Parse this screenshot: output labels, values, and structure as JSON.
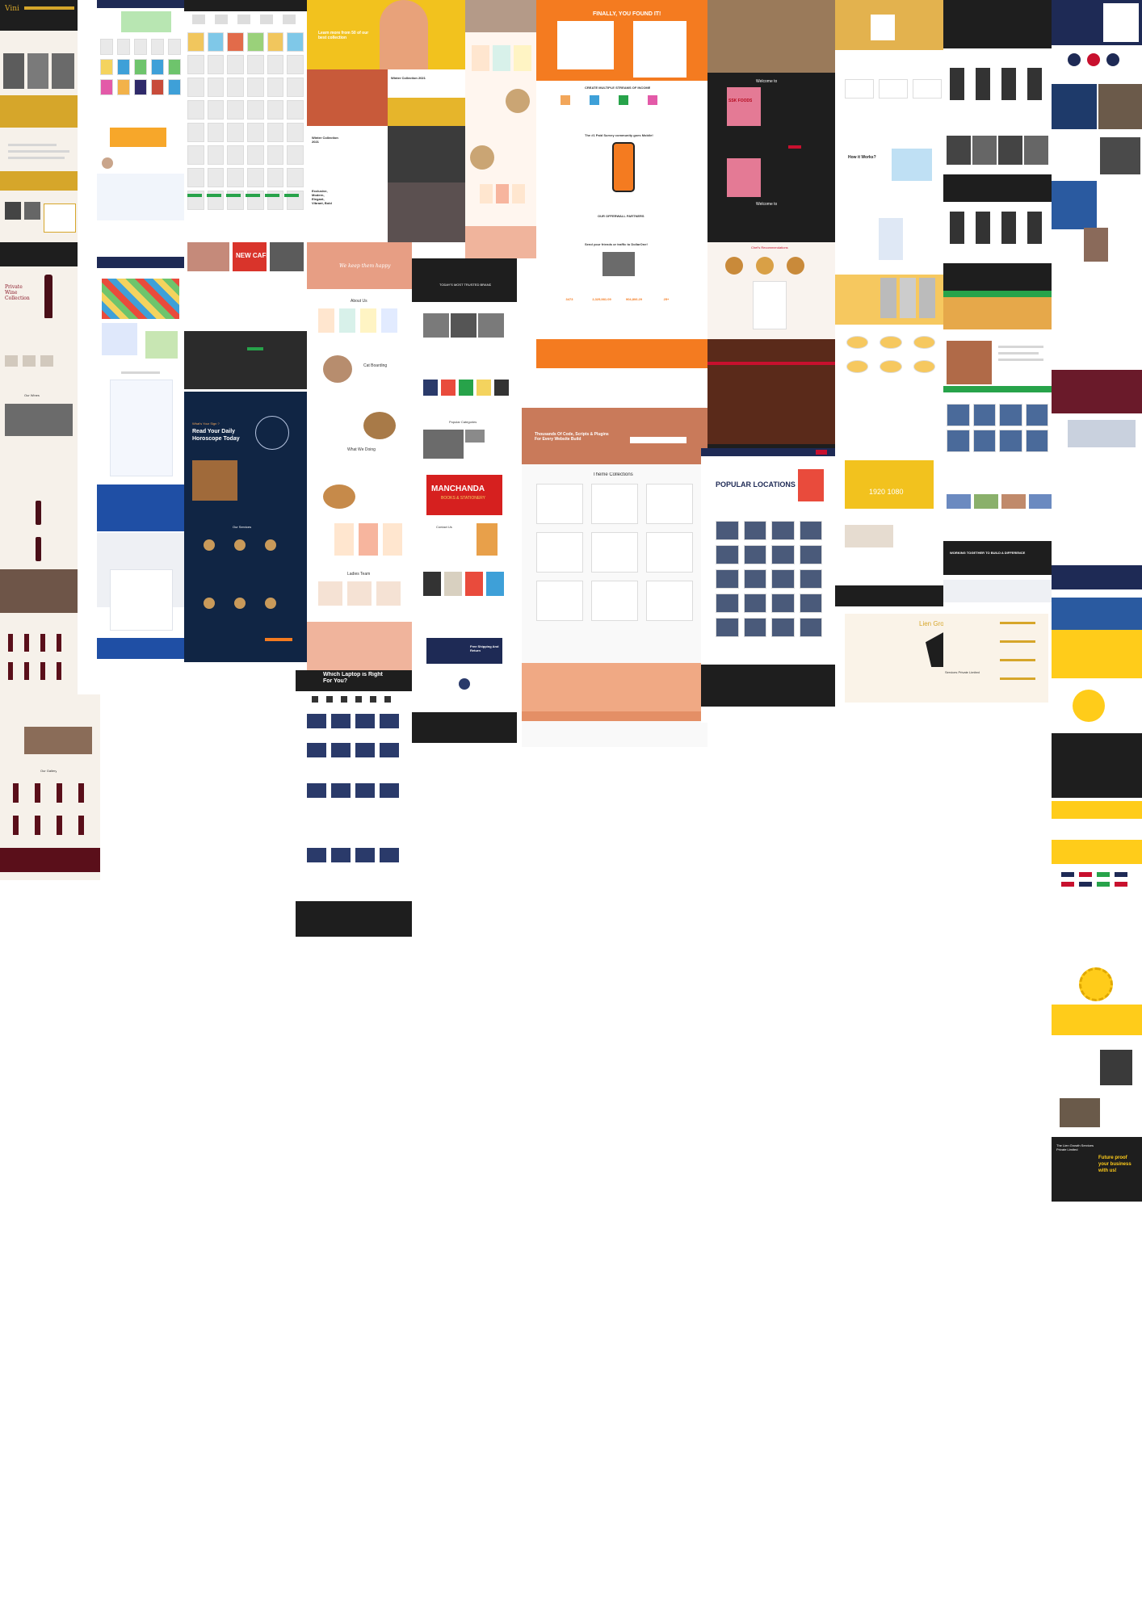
{
  "col_wine": {
    "logo": "Vini",
    "private_collection": "Private\nWine\nCollection",
    "our_wines": "Our Wines",
    "our_gallery": "Our Gallery"
  },
  "col_shop": {
    "cta": "Shop Now"
  },
  "col_store": {
    "promo": "NEW CAFE",
    "horoscope_title": "What's Your Sign ?",
    "horoscope_heading": "Read Your Daily Horoscope Today",
    "our_services": "Our Services"
  },
  "col_fashion": {
    "hero": "Learn more from 50 of our best collection",
    "winter_1": "Winter Collection 2021",
    "winter_2": "Winter Collection 2021",
    "exclusive": "Exclusive, Modern, Elegant, Vibrant, Bold"
  },
  "col_laptop": {
    "title": "Which Laptop is Right For You?"
  },
  "col_pet": {
    "hero": "We keep them happy",
    "about": "About Us",
    "cat_boarding": "Cat Boarding",
    "what_we_doing": "What We Doing",
    "ladies_team": "Ladies Team"
  },
  "col_books": {
    "tagline": "TODAY'S MOST TRUSTED BRAND",
    "brand_name": "MANCHANDA",
    "brand_sub": "BOOKS & STATIONERY",
    "popular_categories": "Popular Categories",
    "contact": "Contact Us",
    "free_shipping": "Free Shipping And Return"
  },
  "col_survey": {
    "title": "FINALLY, YOU FOUND IT!",
    "streams": "CREATE MULTIPLE STREAMS OF INCOME",
    "mobile_title": "The #1 Paid Survey community goes Mobile!",
    "partners": "OUR OFFERWALL PARTNERS",
    "send_friends": "Send your friends or traffic to DollarOne!",
    "stats": [
      "3473",
      "2,325,981.09",
      "904,806.29",
      "25+"
    ]
  },
  "col_theme": {
    "hero": "Thousands Of Code, Scripts & Plugins For Every Website Build",
    "collections": "Theme Collections"
  },
  "col_food": {
    "welcome_1": "Welcome to",
    "welcome_2": "Welcome to",
    "brand": "SSK FOODS",
    "chef": "Chef's Recommendations"
  },
  "col_locations": {
    "title": "POPULAR LOCATIONS"
  },
  "col_app": {
    "how": "How it Works?",
    "stats": "1920 1080",
    "lion": "Lien Growth",
    "lion_sub": "Services Private Limited"
  },
  "col_fashion2": {
    "cta": "Shop Now"
  },
  "col_school": {
    "title": "WORKING TOGETHER TO BUILD A DIFFERENCE"
  },
  "col_corp": {
    "future": "Future proof your business with us!",
    "lien_quote": "The Lien Growth Services Private Limited"
  },
  "colors": {
    "gold": "#d6a62a",
    "navy": "#1e2a55",
    "orange": "#f47b20",
    "peach": "#f0a984",
    "yellow": "#ffcc1a",
    "dark": "#1e1e1e",
    "maroon": "#5a0f1a",
    "red": "#c8102e"
  }
}
